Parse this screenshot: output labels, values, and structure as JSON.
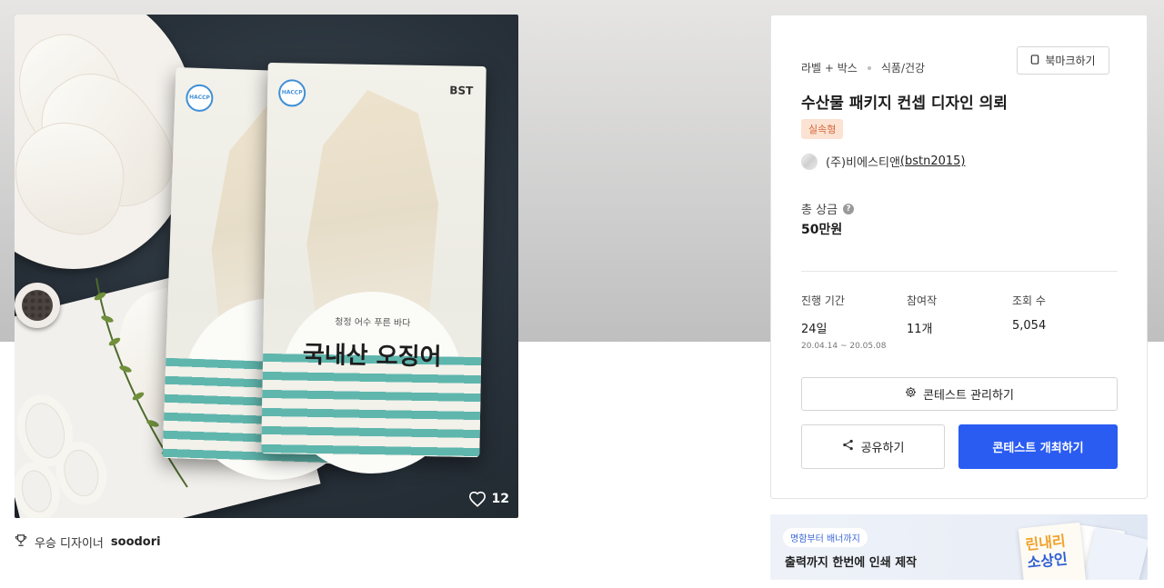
{
  "gallery": {
    "likes": "12",
    "winner_prefix": "우승 디자이너",
    "winner_name": "soodori",
    "image_text": {
      "brand": "BST",
      "haccp": "HACCP",
      "subtitle": "청정 어수  푸른 바다",
      "title": "국내산 오징어"
    }
  },
  "contest": {
    "category": "라벨 + 박스",
    "subcategory": "식품/건강",
    "bookmark_label": "북마크하기",
    "title": "수산물 패키지 컨셉 디자인 의뢰",
    "tag": "실속형",
    "host_name": "(주)비에스티앤",
    "host_id": "(bstn2015)",
    "prize_label": "총 상금",
    "prize_value": "50만원",
    "stats": [
      {
        "label": "진행 기간",
        "value": "24일",
        "range": "20.04.14  ~  20.05.08"
      },
      {
        "label": "참여작",
        "value": "11개"
      },
      {
        "label": "조회 수",
        "value": "5,054"
      }
    ],
    "manage_label": "콘테스트 관리하기",
    "share_label": "공유하기",
    "host_contest_label": "콘테스트 개최하기",
    "accent_color": "#2a5cf2"
  },
  "banner": {
    "pill": "명함부터 배너까지",
    "headline": "출력까지 한번에 인쇄 제작",
    "art_text_1": "린내리",
    "art_text_2": "소상인"
  },
  "icons": {
    "like": "heart-icon",
    "winner": "trophy-icon",
    "bookmark": "bookmark-icon",
    "help": "question-icon",
    "manage": "gear-icon",
    "share": "share-icon"
  }
}
